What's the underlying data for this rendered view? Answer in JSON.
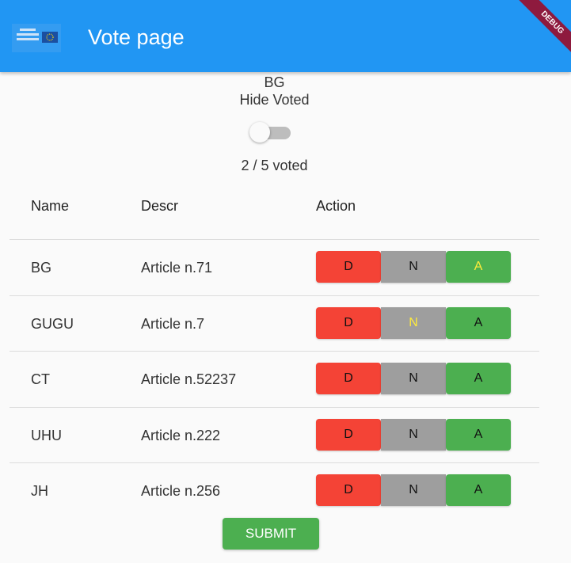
{
  "appbar": {
    "title": "Vote page",
    "debug_label": "DEBUG",
    "logo_icon": "eu-flag-logo-icon"
  },
  "header": {
    "country": "BG",
    "hide_voted_label": "Hide Voted",
    "hide_voted_on": false,
    "voted_summary": "2 / 5 voted"
  },
  "table": {
    "columns": [
      "Name",
      "Descr",
      "Action"
    ],
    "rows": [
      {
        "name": "BG",
        "descr": "Article n.71",
        "vote": "A"
      },
      {
        "name": "GUGU",
        "descr": "Article n.7",
        "vote": "N"
      },
      {
        "name": "CT",
        "descr": "Article n.52237",
        "vote": ""
      },
      {
        "name": "UHU",
        "descr": "Article n.222",
        "vote": ""
      },
      {
        "name": "JH",
        "descr": "Article n.256",
        "vote": ""
      }
    ],
    "options": {
      "d": "D",
      "n": "N",
      "a": "A"
    }
  },
  "submit_label": "SUBMIT",
  "colors": {
    "appbar": "#2196f3",
    "disagree": "#f44336",
    "neutral": "#9e9e9e",
    "agree": "#4caf50",
    "selected_text": "#ffeb3b"
  }
}
